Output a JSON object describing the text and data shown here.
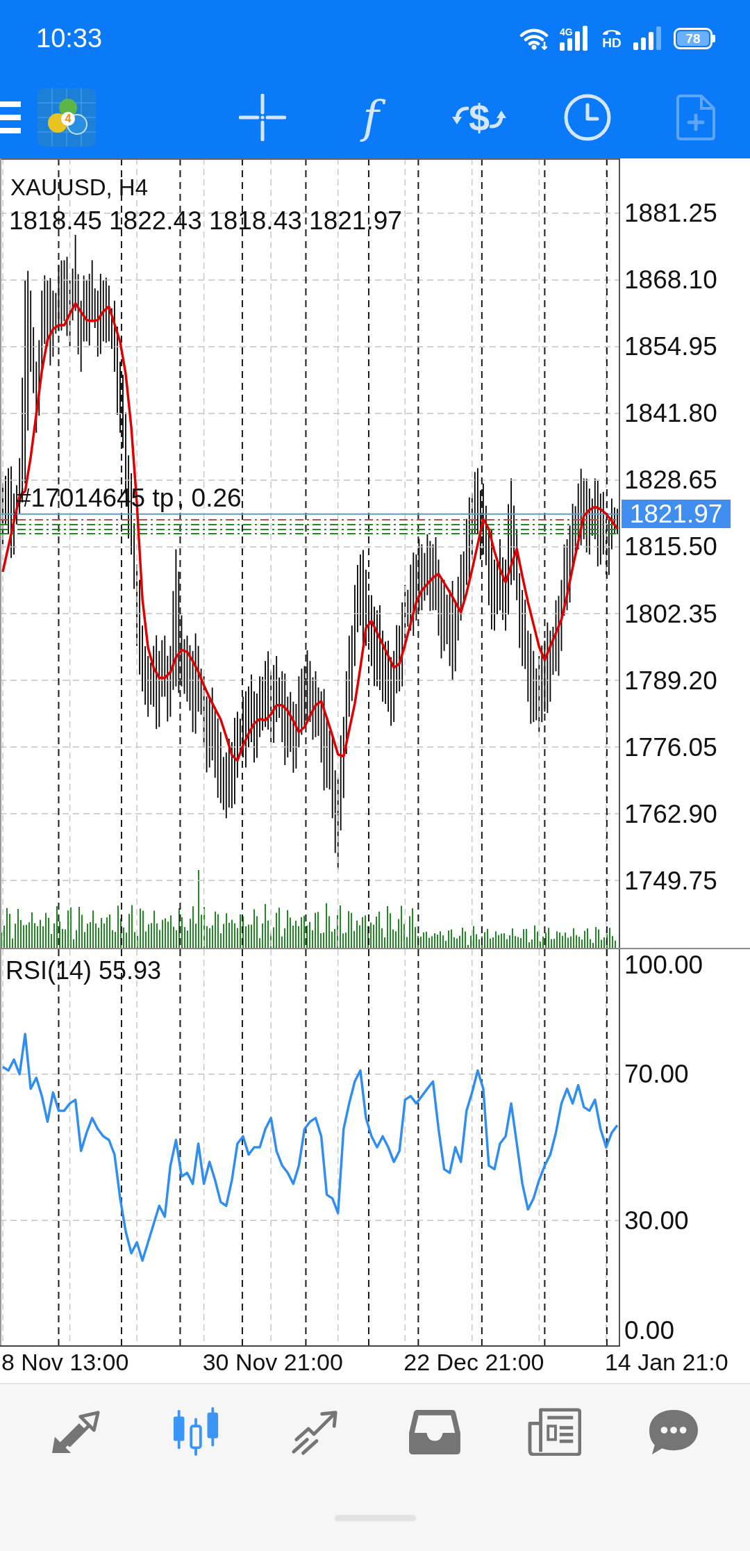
{
  "status_bar": {
    "time": "10:33",
    "network_type": "4G",
    "hd_label": "HD",
    "battery_percent": "78"
  },
  "toolbar": {
    "logo_badge": "4",
    "tools": [
      {
        "kind": "crosshair",
        "disabled": false
      },
      {
        "kind": "glyph",
        "label": "f",
        "disabled": false
      },
      {
        "kind": "exchange",
        "label": "$",
        "disabled": false
      },
      {
        "kind": "clock",
        "disabled": false
      },
      {
        "kind": "new-document",
        "disabled": true
      }
    ]
  },
  "main_chart": {
    "ohlc": "1818.45 1822.43 1818.43 1821.97",
    "order_label": [
      "#17014645 tp",
      ", 0.26"
    ],
    "chart_data": {
      "type": "line",
      "title": "XAUUSD, H4",
      "ylim": [
        1736.48,
        1892.05
      ],
      "grid": true,
      "yticks": [
        {
          "value": 1881.25,
          "label": "1881.25"
        },
        {
          "value": 1868.1,
          "label": "1868.10"
        },
        {
          "value": 1854.95,
          "label": "1854.95"
        },
        {
          "value": 1841.8,
          "label": "1841.80"
        },
        {
          "value": 1828.65,
          "label": "1828.65"
        },
        {
          "value": 1815.5,
          "label": "1815.50"
        },
        {
          "value": 1802.35,
          "label": "1802.35"
        },
        {
          "value": 1789.2,
          "label": "1789.20"
        },
        {
          "value": 1776.05,
          "label": "1776.05"
        },
        {
          "value": 1762.9,
          "label": "1762.90"
        },
        {
          "value": 1749.75,
          "label": "1749.75"
        }
      ],
      "series": [
        {
          "color": "#e00000",
          "values": [
            1810.6,
            1815.6,
            1820.5,
            1825.5,
            1826.5,
            1833.2,
            1841.7,
            1850.2,
            1856.3,
            1858.4,
            1859.2,
            1859.2,
            1861.4,
            1863.5,
            1861.8,
            1860.2,
            1860.0,
            1860.2,
            1861.9,
            1862.9,
            1859.4,
            1855.9,
            1849.6,
            1839.0,
            1824.0,
            1805.2,
            1795.6,
            1791.7,
            1789.7,
            1789.7,
            1790.8,
            1793.7,
            1795.2,
            1794.8,
            1793.0,
            1790.9,
            1788.2,
            1785.8,
            1783.6,
            1781.5,
            1778.1,
            1774.5,
            1773.4,
            1776.4,
            1778.7,
            1780.7,
            1781.6,
            1781.3,
            1782.5,
            1784.3,
            1784.3,
            1783.2,
            1781.2,
            1779.0,
            1780.0,
            1782.2,
            1784.3,
            1785.1,
            1781.8,
            1778.3,
            1774.6,
            1774.2,
            1779.4,
            1784.6,
            1791.7,
            1799.5,
            1800.9,
            1798.6,
            1796.3,
            1794.0,
            1791.7,
            1792.5,
            1796.3,
            1800.4,
            1804.6,
            1806.9,
            1808.2,
            1809.4,
            1810.2,
            1808.4,
            1806.6,
            1804.6,
            1802.6,
            1806.4,
            1811.0,
            1816.0,
            1821.0,
            1819.0,
            1814.6,
            1811.1,
            1808.5,
            1811.8,
            1815.1,
            1809.7,
            1804.6,
            1800.2,
            1795.8,
            1793.2,
            1795.9,
            1798.5,
            1801.2,
            1806.0,
            1811.4,
            1816.5,
            1821.6,
            1822.8,
            1823.4,
            1822.9,
            1822.0,
            1820.6,
            1819.1
          ]
        }
      ],
      "ref_lines": [
        {
          "axis": "y",
          "value": 1821.97,
          "color": "#5a9fe0",
          "label": "1821.97"
        },
        {
          "axis": "y",
          "value": 1820.83,
          "color": "#c0504d"
        },
        {
          "axis": "y",
          "value": 1819.87,
          "color": "#1e8c1e"
        },
        {
          "axis": "y",
          "value": 1818.91,
          "color": "#1e8c1e"
        },
        {
          "axis": "y",
          "value": 1818.09,
          "color": "#1e8c1e"
        }
      ]
    }
  },
  "rsi_chart": {
    "chart_data": {
      "type": "line",
      "title": "RSI(14) 55.93",
      "ylim": [
        -4.18,
        104.18
      ],
      "grid": true,
      "yticks": [
        {
          "value": 100,
          "label": "100.00"
        },
        {
          "value": 70,
          "label": "70.00"
        },
        {
          "value": 30,
          "label": "30.00"
        },
        {
          "value": 0,
          "label": "0.00"
        }
      ],
      "series": [
        {
          "color": "#2f8ef0",
          "values": [
            72,
            71,
            74,
            70,
            81,
            66,
            69,
            64,
            57,
            65,
            60,
            60,
            62,
            63,
            49,
            54,
            58,
            55,
            53,
            52,
            48,
            36,
            27,
            21,
            24,
            19,
            24,
            29,
            34,
            31,
            45,
            52,
            42,
            43,
            40,
            51,
            40,
            46,
            41,
            35,
            34,
            41,
            51,
            53,
            48,
            50,
            50,
            55,
            58,
            49,
            45,
            43,
            40,
            45,
            55,
            57,
            58,
            53,
            37,
            36,
            32,
            55,
            62,
            68,
            71,
            58,
            53,
            50,
            53,
            50,
            46,
            49,
            63,
            64,
            62,
            64,
            66,
            68,
            55,
            44,
            43,
            50,
            46,
            60,
            65,
            71,
            66,
            45,
            44,
            51,
            53,
            62,
            51,
            40,
            33,
            36,
            41,
            45,
            48,
            54,
            62,
            66,
            62,
            67,
            61,
            60,
            63,
            55,
            50,
            54,
            56
          ]
        }
      ]
    },
    "time_axis": [
      "8 Nov 13:00",
      "30 Nov 21:00",
      "22 Dec 21:00",
      "14 Jan 21:0"
    ]
  },
  "bottom_nav": {
    "items": [
      {
        "kind": "arrows",
        "selected": false
      },
      {
        "kind": "candles",
        "selected": true
      },
      {
        "kind": "trend",
        "selected": false
      },
      {
        "kind": "tray",
        "selected": false
      },
      {
        "kind": "newspaper",
        "selected": false
      },
      {
        "kind": "chat",
        "selected": false
      }
    ]
  }
}
